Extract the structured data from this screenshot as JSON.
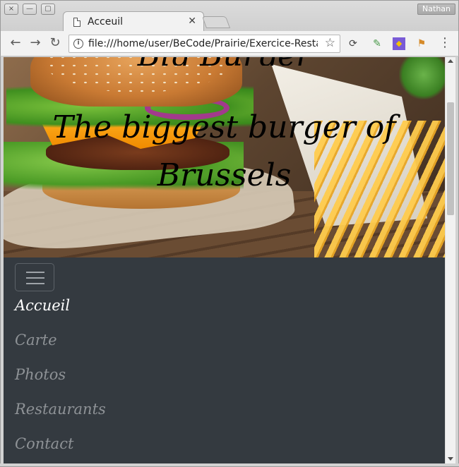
{
  "window": {
    "close_icon": "×",
    "minimize_icon": "—",
    "maximize_icon": "▢",
    "user": "Nathan"
  },
  "tab": {
    "title": "Acceuil",
    "close": "✕"
  },
  "toolbar": {
    "back": "←",
    "forward": "→",
    "reload": "↻",
    "info": "i",
    "url": "file:///home/user/BeCode/Prairie/Exercice-Resta...",
    "star": "☆",
    "menu": "⋮"
  },
  "hero": {
    "top_partial": "Big Burger",
    "line1": "The biggest burger of",
    "line2": "Brussels"
  },
  "nav": {
    "items": [
      {
        "label": "Accueil",
        "active": true
      },
      {
        "label": "Carte",
        "active": false
      },
      {
        "label": "Photos",
        "active": false
      },
      {
        "label": "Restaurants",
        "active": false
      },
      {
        "label": "Contact",
        "active": false
      }
    ]
  },
  "colors": {
    "navbar_bg": "#343a40",
    "nav_active": "#ffffff",
    "nav_inactive": "#8e9296"
  }
}
